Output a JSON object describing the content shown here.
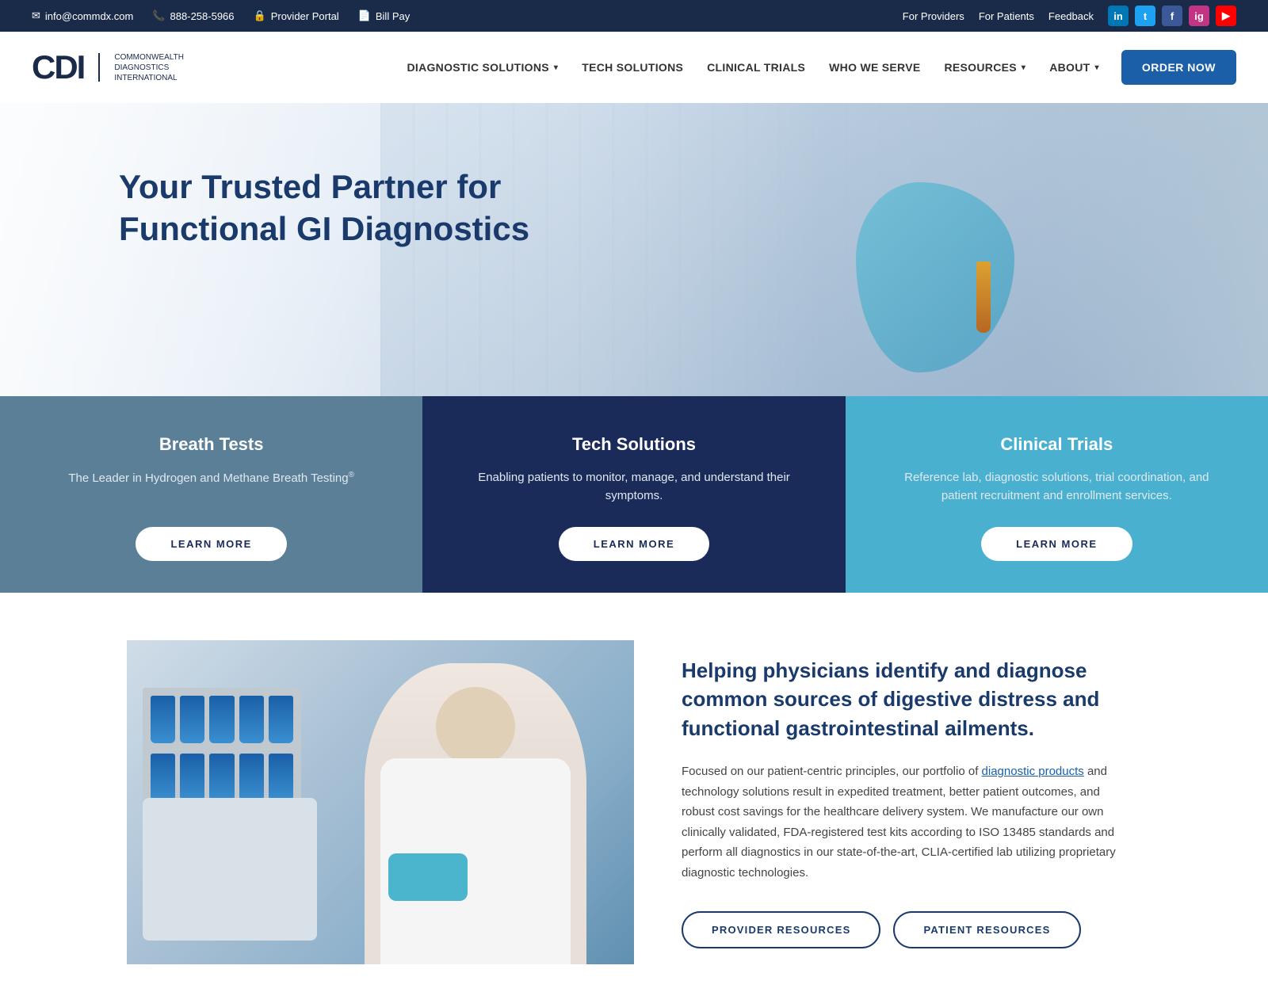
{
  "topbar": {
    "email": "info@commdx.com",
    "phone": "888-258-5966",
    "portal": "Provider Portal",
    "bill": "Bill Pay",
    "for_providers": "For Providers",
    "for_patients": "For Patients",
    "feedback": "Feedback"
  },
  "nav": {
    "logo_main": "CDI",
    "logo_sub1": "COMMONWEALTH",
    "logo_sub2": "DIAGNOSTICS",
    "logo_sub3": "INTERNATIONAL",
    "items": [
      {
        "label": "DIAGNOSTIC SOLUTIONS",
        "has_dropdown": true
      },
      {
        "label": "TECH SOLUTIONS",
        "has_dropdown": false
      },
      {
        "label": "CLINICAL TRIALS",
        "has_dropdown": false
      },
      {
        "label": "WHO WE SERVE",
        "has_dropdown": false
      },
      {
        "label": "RESOURCES",
        "has_dropdown": true
      },
      {
        "label": "ABOUT",
        "has_dropdown": true
      }
    ],
    "order_btn": "ORDER NOW"
  },
  "hero": {
    "title_line1": "Your Trusted Partner for",
    "title_line2": "Functional GI Diagnostics"
  },
  "cards": [
    {
      "id": "breath",
      "title": "Breath Tests",
      "desc": "The Leader in Hydrogen and Methane Breath Testing®",
      "btn": "LEARN MORE"
    },
    {
      "id": "tech",
      "title": "Tech Solutions",
      "desc": "Enabling patients to monitor, manage, and understand their symptoms.",
      "btn": "LEARN MORE"
    },
    {
      "id": "clinical",
      "title": "Clinical Trials",
      "desc": "Reference lab, diagnostic solutions, trial coordination, and patient recruitment and enrollment services.",
      "btn": "LEARN MORE"
    }
  ],
  "lower": {
    "heading": "Helping physicians identify and diagnose common sources of digestive distress and functional gastrointestinal ailments.",
    "body_prefix": "Focused on our patient-centric principles, our portfolio of ",
    "body_link": "diagnostic products",
    "body_suffix": " and technology solutions result in expedited treatment, better patient outcomes, and robust cost savings for the healthcare delivery system. We manufacture our own clinically validated, FDA-registered test kits according to ISO 13485 standards and perform all diagnostics in our state-of-the-art, CLIA-certified lab utilizing proprietary diagnostic technologies.",
    "btn_provider": "PROVIDER RESOURCES",
    "btn_patient": "PATIENT RESOURCES"
  },
  "social": {
    "linkedin": "in",
    "twitter": "t",
    "facebook": "f",
    "instagram": "ig",
    "youtube": "▶"
  }
}
